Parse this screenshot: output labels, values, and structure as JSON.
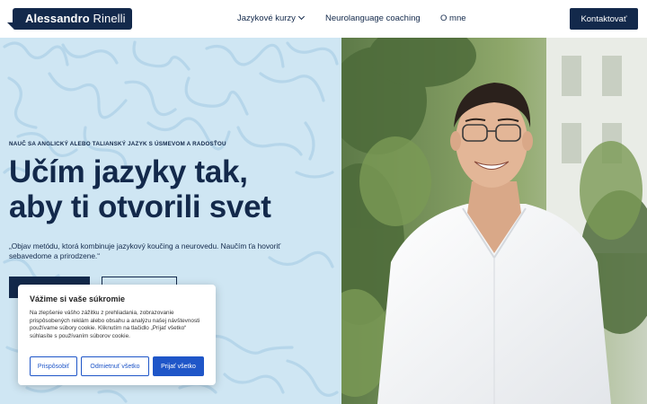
{
  "header": {
    "logo_first": "Alessandro",
    "logo_last": "Rinelli",
    "nav": {
      "kurzy": "Jazykové kurzy",
      "coaching": "Neurolanguage coaching",
      "omne": "O mne"
    },
    "cta_label": "Kontaktovať"
  },
  "hero": {
    "kicker": "NAUČ SA ANGLICKÝ ALEBO TALIANSKÝ JAZYK S ÚSMEVOM A RADOSŤOU",
    "headline_line1": "Učím jazyky tak,",
    "headline_line2": "aby ti otvorili svet",
    "quote_line1": "„Objav metódu, ktorá kombinuje jazykový koučing a neurovedu. Naučím ťa hovoriť",
    "quote_line2": "sebavedome a prirodzene.“"
  },
  "cookie": {
    "title": "Vážime si vaše súkromie",
    "text": "Na zlepšenie vášho zážitku z prehliadania, zobrazovanie prispôsobených reklám alebo obsahu a analýzu našej návštevnosti používame súbory cookie. Kliknutím na tlačidlo „Prijať všetko“ súhlasíte s používaním súborov cookie.",
    "btn_customize": "Prispôsobiť",
    "btn_reject": "Odmietnuť všetko",
    "btn_accept": "Prijať všetko"
  },
  "colors": {
    "navy": "#13294b",
    "hero_bg": "#cfe6f3",
    "cookie_accent": "#1f56c8"
  }
}
